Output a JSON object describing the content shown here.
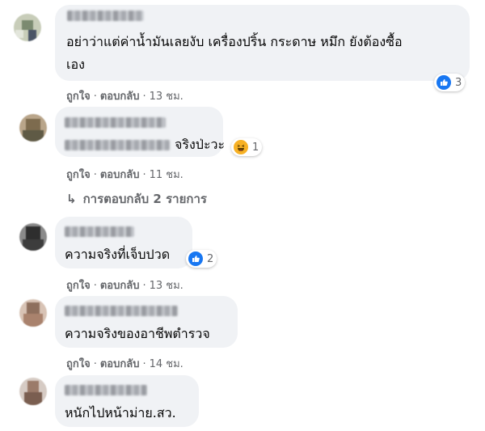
{
  "comments": [
    {
      "text_lines": [
        "อย่าว่าแต่ค่าน้ำมันเลยงับ เครื่องปริ้น กระดาษ หมึก ยังต้องซื้อ",
        "เอง"
      ],
      "reaction_count": "3",
      "reaction_type": "like-icon",
      "time": "13 ชม."
    },
    {
      "text_lines": [
        "จริงป่ะวะ"
      ],
      "reaction_count": "1",
      "reaction_type": "haha-icon",
      "time": "11 ชม.",
      "replies_label": "การตอบกลับ 2 รายการ"
    },
    {
      "text_lines": [
        "ความจริงที่เจ็บปวด"
      ],
      "reaction_count": "2",
      "reaction_type": "like-icon",
      "time": "13 ชม."
    },
    {
      "text_lines": [
        "ความจริงของอาชีพตำรวจ"
      ],
      "time": "14 ชม."
    },
    {
      "text_lines": [
        "หนักไปหน้าม่าย.สว."
      ]
    }
  ],
  "actions": {
    "like": "ถูกใจ",
    "reply": "ตอบกลับ",
    "separator": "·"
  },
  "colors": {
    "bubble": "#f0f2f5",
    "meta_text": "#65676b",
    "like_blue": "#1877f2",
    "haha_yellow": "#f7b125"
  }
}
